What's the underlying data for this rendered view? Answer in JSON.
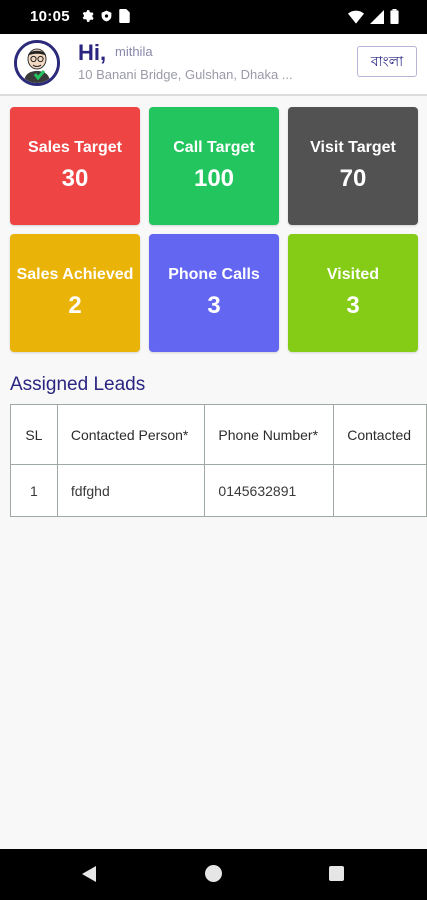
{
  "status_bar": {
    "time": "10:05",
    "left_icons": [
      "gear-icon",
      "shield-icon",
      "sim-card-icon"
    ],
    "right_icons": [
      "wifi-icon",
      "signal-icon",
      "battery-icon"
    ]
  },
  "header": {
    "greeting": "Hi,",
    "username": "mithila",
    "address": "10 Banani Bridge, Gulshan, Dhaka ...",
    "language_button": "বাংলা"
  },
  "cards": [
    {
      "title": "Sales Target",
      "value": "30",
      "color": "#ef4444"
    },
    {
      "title": "Call Target",
      "value": "100",
      "color": "#22c55e"
    },
    {
      "title": "Visit Target",
      "value": "70",
      "color": "#525252"
    },
    {
      "title": "Sales Achieved",
      "value": "2",
      "color": "#eab308"
    },
    {
      "title": "Phone Calls",
      "value": "3",
      "color": "#6366f1"
    },
    {
      "title": "Visited",
      "value": "3",
      "color": "#84cc16"
    }
  ],
  "leads": {
    "title": "Assigned Leads",
    "columns": [
      "SL",
      "Contacted Person*",
      "Phone Number*",
      "Contacted"
    ],
    "rows": [
      [
        "1",
        "fdfghd",
        "0145632891",
        ""
      ]
    ]
  },
  "colors": {
    "primary": "#2a2580",
    "screen_background": "#f8f8f8"
  }
}
